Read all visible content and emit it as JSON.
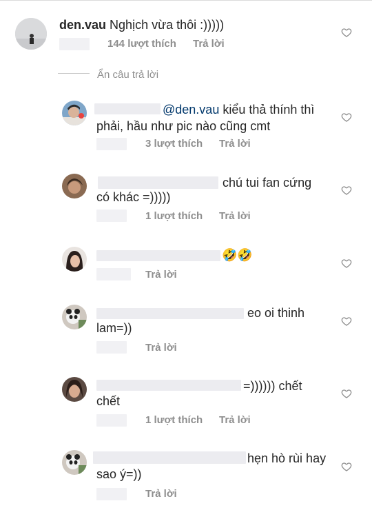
{
  "top_comment": {
    "username": "den.vau",
    "text": "Nghịch vừa thôi :)))))",
    "likes": "144 lượt thích",
    "reply": "Trả lời"
  },
  "hide_replies": "Ẩn câu trả lời",
  "replies": [
    {
      "mention": "@den.vau",
      "text_line1": " kiểu thả thính thì",
      "text_line2": "phải, hầu như pic nào cũng cmt",
      "likes": "3 lượt thích",
      "reply": "Trả lời"
    },
    {
      "text_line1": "chú tui fan cứng",
      "text_line2": "có khác =)))))",
      "likes": "1 lượt thích",
      "reply": "Trả lời"
    },
    {
      "text_line1": "🤣🤣",
      "reply": "Trả lời"
    },
    {
      "text_line1": "eo oi thinh",
      "text_line2": "lam=))",
      "reply": "Trả lời"
    },
    {
      "text_line1": "=)))))) chết",
      "text_line2": "chết",
      "likes": "1 lượt thích",
      "reply": "Trả lời"
    },
    {
      "text_line1": "hẹn hò rùi hay",
      "text_line2": "sao ý=))",
      "reply": "Trả lời"
    }
  ],
  "icons": {
    "like": "heart-outline-icon"
  }
}
